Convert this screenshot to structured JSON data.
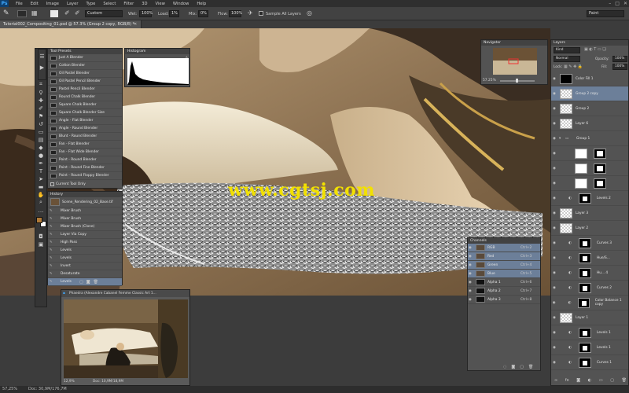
{
  "menu": {
    "logo": "Ps",
    "items": [
      "File",
      "Edit",
      "Image",
      "Layer",
      "Type",
      "Select",
      "Filter",
      "3D",
      "View",
      "Window",
      "Help"
    ]
  },
  "window_controls": [
    "–",
    "□",
    "✕"
  ],
  "options_bar": {
    "blend_mode": "Custom",
    "wet_label": "Wet:",
    "wet_value": "100%",
    "load_label": "Load:",
    "load_value": "1%",
    "mix_label": "Mix:",
    "mix_value": "0%",
    "flow_label": "Flow:",
    "flow_value": "100%",
    "sample_all_layers": "Sample All Layers",
    "workspace": "Paint"
  },
  "document_tab": {
    "title": "Tutorial002_Compositing_01.psd @ 57.3% (Group 2 copy, RGB/8) *",
    "close": "✕"
  },
  "watermark": "www.cgtsj.com",
  "tool_presets": {
    "tab": "Tool Presets",
    "items": [
      "Just A Blender",
      "Cotton Blender",
      "Oil Pastel Blender",
      "Oil Pastel Pencil Blender",
      "Pastel Pencil Blender",
      "Round Chalk Blender",
      "Square Chalk Blender",
      "Square Chalk Blender Size",
      "Angle - Flat Blender",
      "Angle - Round Blender",
      "Blunt - Round Blender",
      "Fan - Flat Blender",
      "Fan - Flat Wide Blender",
      "Point - Round Blender",
      "Point - Round Fine Blender",
      "Point - Round Floppy Blender"
    ],
    "current_only": "Current Tool Only"
  },
  "histogram": {
    "tab": "Histogram"
  },
  "history": {
    "tab": "History",
    "snapshot": "Scene_Rendering_02_Base.tif",
    "items": [
      "Mixer Brush",
      "Mixer Brush",
      "Mixer Brush (Clone)",
      "Layer Via Copy",
      "High Pass",
      "Levels",
      "Levels",
      "Invert",
      "Desaturate",
      "Levels"
    ]
  },
  "navigator": {
    "tab": "Navigator",
    "zoom": "57.25%"
  },
  "layers": {
    "tab": "Layers",
    "kind": "Kind",
    "blend": "Normal",
    "opacity_label": "Opacity:",
    "opacity": "100%",
    "lock_label": "Lock:",
    "fill_label": "Fill:",
    "fill": "100%",
    "rows": [
      {
        "name": "Color Fill 1",
        "kind": "fill"
      },
      {
        "name": "Group 2 copy",
        "kind": "layer",
        "selected": true
      },
      {
        "name": "Group 2",
        "kind": "layer"
      },
      {
        "name": "Layer 6",
        "kind": "layer"
      },
      {
        "name": "Group 1",
        "kind": "group"
      },
      {
        "name": "",
        "kind": "mask"
      },
      {
        "name": "",
        "kind": "mask"
      },
      {
        "name": "",
        "kind": "mask"
      },
      {
        "name": "Levels 2",
        "kind": "adjust"
      },
      {
        "name": "Layer 3",
        "kind": "layer"
      },
      {
        "name": "Layer 2",
        "kind": "layer"
      },
      {
        "name": "Curves 3",
        "kind": "adjust"
      },
      {
        "name": "Hue/S...",
        "kind": "adjust"
      },
      {
        "name": "Hu... 4",
        "kind": "adjust"
      },
      {
        "name": "Curves 2",
        "kind": "adjust"
      },
      {
        "name": "Color Balance 1 copy",
        "kind": "adjust"
      },
      {
        "name": "Layer 1",
        "kind": "layer"
      },
      {
        "name": "Levels 1",
        "kind": "adjust"
      },
      {
        "name": "Levels 1",
        "kind": "adjust"
      },
      {
        "name": "Curves 1",
        "kind": "adjust"
      }
    ]
  },
  "channels": {
    "tab": "Channels",
    "rows": [
      {
        "name": "RGB",
        "key": "Ctrl+2",
        "selected": true
      },
      {
        "name": "Red",
        "key": "Ctrl+3",
        "selected": true
      },
      {
        "name": "Green",
        "key": "Ctrl+4",
        "selected": true
      },
      {
        "name": "Blue",
        "key": "Ctrl+5",
        "selected": true
      },
      {
        "name": "Alpha 1",
        "key": "Ctrl+6",
        "selected": false
      },
      {
        "name": "Alpha 2",
        "key": "Ctrl+7",
        "selected": false
      },
      {
        "name": "Alpha 3",
        "key": "Ctrl+8",
        "selected": false
      }
    ]
  },
  "reference_window": {
    "title": "Phaedra (Alexandre Cabanel Femme Classic Art 1...",
    "zoom": "12,9%",
    "doc": "Doc: 10,9M/18,9M"
  },
  "status": {
    "zoom": "57,25%",
    "doc": "Doc: 30,9M/176,7M"
  },
  "colors": {
    "accent_selected": "#6c7f99",
    "watermark": "#f2e100",
    "foreground_swatch": "#b07a38",
    "background_swatch": "#ffffff"
  }
}
